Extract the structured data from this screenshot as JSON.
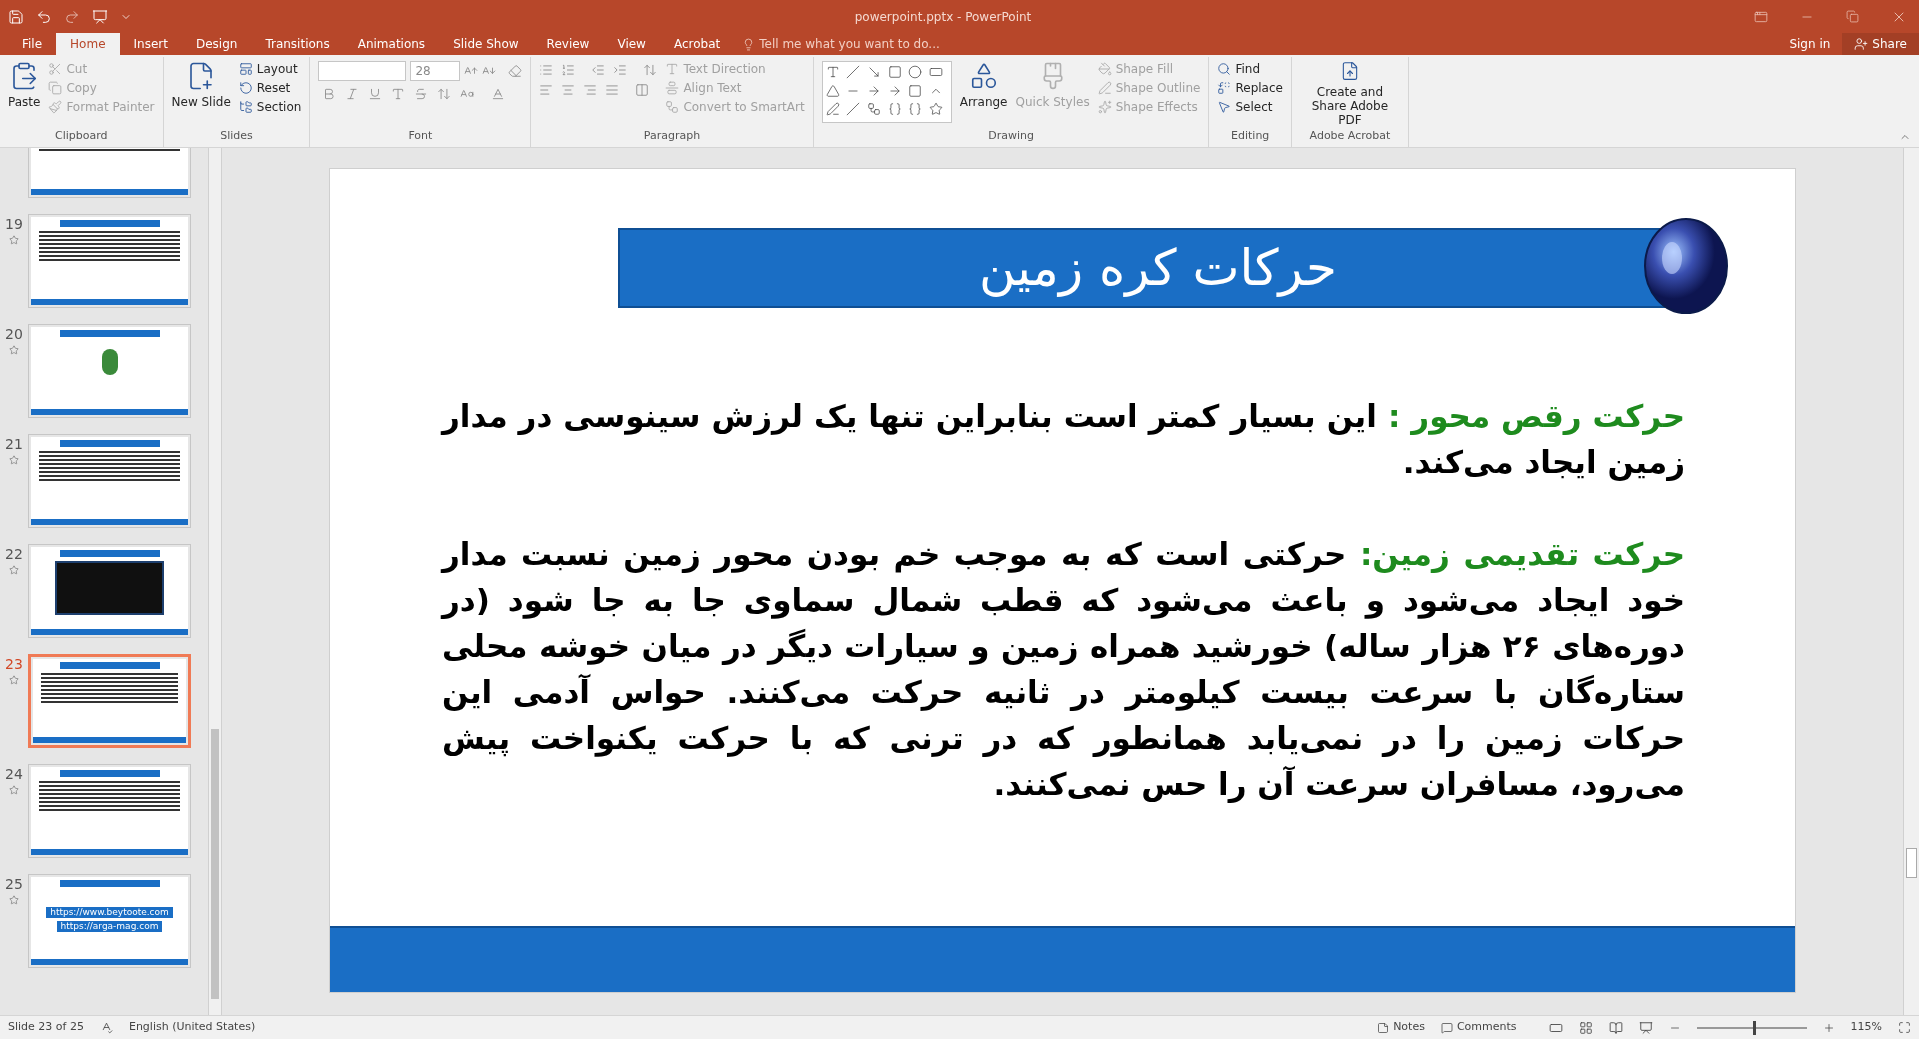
{
  "window": {
    "title": "powerpoint.pptx - PowerPoint"
  },
  "tabs": [
    {
      "label": "File",
      "selected": false
    },
    {
      "label": "Home",
      "selected": true
    },
    {
      "label": "Insert",
      "selected": false
    },
    {
      "label": "Design",
      "selected": false
    },
    {
      "label": "Transitions",
      "selected": false
    },
    {
      "label": "Animations",
      "selected": false
    },
    {
      "label": "Slide Show",
      "selected": false
    },
    {
      "label": "Review",
      "selected": false
    },
    {
      "label": "View",
      "selected": false
    },
    {
      "label": "Acrobat",
      "selected": false
    }
  ],
  "tell_me": {
    "placeholder": "Tell me what you want to do..."
  },
  "account": {
    "sign_in": "Sign in",
    "share": "Share"
  },
  "ribbon": [
    {
      "kind": "clipboard",
      "label": "Clipboard",
      "large": [
        {
          "label": "Paste",
          "disabled": false
        }
      ],
      "small": [
        {
          "label": "Cut",
          "disabled": true
        },
        {
          "label": "Copy",
          "disabled": true
        },
        {
          "label": "Format Painter",
          "disabled": true
        }
      ]
    },
    {
      "kind": "slides",
      "label": "Slides",
      "large": [
        {
          "label": "New Slide",
          "disabled": false
        }
      ],
      "small": [
        {
          "label": "Layout",
          "disabled": false
        },
        {
          "label": "Reset",
          "disabled": false
        },
        {
          "label": "Section",
          "disabled": false
        }
      ]
    },
    {
      "kind": "font",
      "label": "Font",
      "font_size": "28"
    },
    {
      "kind": "paragraph",
      "label": "Paragraph",
      "small": [
        {
          "label": "Text Direction",
          "disabled": true
        },
        {
          "label": "Align Text",
          "disabled": true
        },
        {
          "label": "Convert to SmartArt",
          "disabled": true
        }
      ]
    },
    {
      "kind": "drawing",
      "label": "Drawing",
      "large": [
        {
          "label": "Arrange",
          "disabled": false
        },
        {
          "label": "Quick Styles",
          "disabled": true
        }
      ],
      "small": [
        {
          "label": "Shape Fill",
          "disabled": true
        },
        {
          "label": "Shape Outline",
          "disabled": true
        },
        {
          "label": "Shape Effects",
          "disabled": true
        }
      ]
    },
    {
      "kind": "editing",
      "label": "Editing",
      "small": [
        {
          "label": "Find",
          "disabled": false
        },
        {
          "label": "Replace",
          "disabled": false
        },
        {
          "label": "Select",
          "disabled": false
        }
      ]
    },
    {
      "kind": "acrobat",
      "label": "Adobe Acrobat",
      "large": [
        {
          "label": "Create and Share Adobe PDF",
          "disabled": false
        }
      ]
    }
  ],
  "thumbnails": [
    {
      "kind": "text",
      "selected": false
    },
    {
      "number": "19",
      "kind": "text",
      "selected": false
    },
    {
      "number": "20",
      "kind": "figure",
      "selected": false
    },
    {
      "number": "21",
      "kind": "text",
      "selected": false
    },
    {
      "number": "22",
      "kind": "image",
      "selected": false
    },
    {
      "number": "23",
      "kind": "text",
      "selected": true
    },
    {
      "number": "24",
      "kind": "text",
      "selected": false
    },
    {
      "number": "25",
      "kind": "links",
      "selected": false,
      "links": [
        "https://www.beytoote.com",
        "https://arga-mag.com"
      ]
    }
  ],
  "slide": {
    "title": "حرکات کره زمین",
    "paragraphs": [
      {
        "term": "حرکت رقص محور :",
        "text": "این بسیار کمتر است بنابراین تنها یک لرزش سینوسی در مدار زمین ایجاد می‌کند."
      },
      {
        "term": "حرکت تقدیمی زمین:",
        "text": "حرکتی است که به موجب خم بودن محور زمین نسبت مدار خود ایجاد می‌شود و باعث می‌شود که قطب شمال سماوی جا به جا شود (در دوره‌های ۲۶ هزار ساله) خورشید همراه زمین و سیارات دیگر در میان خوشه محلی ستاره‌گان با سرعت بیست کیلومتر در ثانیه حرکت می‌کنند. حواس آدمی این حرکات زمین را در نمی‌یابد همانطور که در ترنی که با حرکت یکنواخت پیش می‌رود، مسافران سرعت آن را حس نمی‌کنند."
      }
    ]
  },
  "status_bar": {
    "slide": "Slide 23 of 25",
    "language": "English (United States)",
    "notes": "Notes",
    "comments": "Comments",
    "zoom": "115%",
    "zoom_slider": {
      "level": 0.53
    }
  }
}
